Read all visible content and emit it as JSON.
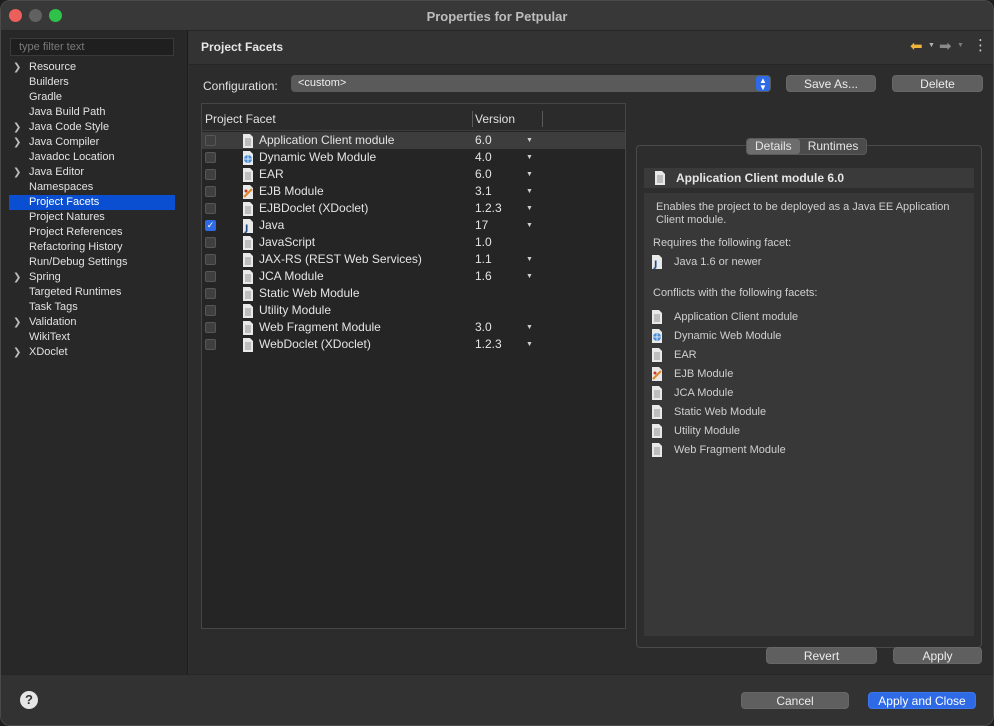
{
  "window": {
    "title": "Properties for Petpular"
  },
  "filter": {
    "placeholder": "type filter text"
  },
  "tree": [
    {
      "label": "Resource",
      "expandable": true
    },
    {
      "label": "Builders",
      "expandable": false
    },
    {
      "label": "Gradle",
      "expandable": false
    },
    {
      "label": "Java Build Path",
      "expandable": false
    },
    {
      "label": "Java Code Style",
      "expandable": true
    },
    {
      "label": "Java Compiler",
      "expandable": true
    },
    {
      "label": "Javadoc Location",
      "expandable": false
    },
    {
      "label": "Java Editor",
      "expandable": true
    },
    {
      "label": "Namespaces",
      "expandable": false
    },
    {
      "label": "Project Facets",
      "expandable": false,
      "selected": true
    },
    {
      "label": "Project Natures",
      "expandable": false
    },
    {
      "label": "Project References",
      "expandable": false
    },
    {
      "label": "Refactoring History",
      "expandable": false
    },
    {
      "label": "Run/Debug Settings",
      "expandable": false
    },
    {
      "label": "Spring",
      "expandable": true
    },
    {
      "label": "Targeted Runtimes",
      "expandable": false
    },
    {
      "label": "Task Tags",
      "expandable": false
    },
    {
      "label": "Validation",
      "expandable": true
    },
    {
      "label": "WikiText",
      "expandable": false
    },
    {
      "label": "XDoclet",
      "expandable": true
    }
  ],
  "page": {
    "title": "Project Facets",
    "config_label": "Configuration:",
    "config_value": "<custom>",
    "save_as": "Save As...",
    "delete": "Delete"
  },
  "table": {
    "col_facet": "Project Facet",
    "col_version": "Version",
    "rows": [
      {
        "name": "Application Client module",
        "version": "6.0",
        "checked": false,
        "dropdown": true,
        "icon": "doc-icon"
      },
      {
        "name": "Dynamic Web Module",
        "version": "4.0",
        "checked": false,
        "dropdown": true,
        "icon": "globe-icon"
      },
      {
        "name": "EAR",
        "version": "6.0",
        "checked": false,
        "dropdown": true,
        "icon": "doc-icon"
      },
      {
        "name": "EJB Module",
        "version": "3.1",
        "checked": false,
        "dropdown": true,
        "icon": "bean-icon"
      },
      {
        "name": "EJBDoclet (XDoclet)",
        "version": "1.2.3",
        "checked": false,
        "dropdown": true,
        "icon": "doc-icon"
      },
      {
        "name": "Java",
        "version": "17",
        "checked": true,
        "dropdown": true,
        "icon": "java-icon"
      },
      {
        "name": "JavaScript",
        "version": "1.0",
        "checked": false,
        "dropdown": false,
        "icon": "doc-icon"
      },
      {
        "name": "JAX-RS (REST Web Services)",
        "version": "1.1",
        "checked": false,
        "dropdown": true,
        "icon": "doc-icon"
      },
      {
        "name": "JCA Module",
        "version": "1.6",
        "checked": false,
        "dropdown": true,
        "icon": "doc-icon"
      },
      {
        "name": "Static Web Module",
        "version": "",
        "checked": false,
        "dropdown": false,
        "icon": "doc-icon"
      },
      {
        "name": "Utility Module",
        "version": "",
        "checked": false,
        "dropdown": false,
        "icon": "doc-icon"
      },
      {
        "name": "Web Fragment Module",
        "version": "3.0",
        "checked": false,
        "dropdown": true,
        "icon": "doc-icon"
      },
      {
        "name": "WebDoclet (XDoclet)",
        "version": "1.2.3",
        "checked": false,
        "dropdown": true,
        "icon": "doc-icon"
      }
    ]
  },
  "details": {
    "tab_details": "Details",
    "tab_runtimes": "Runtimes",
    "title": "Application Client module 6.0",
    "description": "Enables the project to be deployed as a Java EE Application Client module.",
    "requires_label": "Requires the following facet:",
    "requires": [
      {
        "name": "Java 1.6 or newer",
        "icon": "java-icon"
      }
    ],
    "conflicts_label": "Conflicts with the following facets:",
    "conflicts": [
      {
        "name": "Application Client module",
        "icon": "doc-icon"
      },
      {
        "name": "Dynamic Web Module",
        "icon": "globe-icon"
      },
      {
        "name": "EAR",
        "icon": "doc-icon"
      },
      {
        "name": "EJB Module",
        "icon": "bean-icon"
      },
      {
        "name": "JCA Module",
        "icon": "doc-icon"
      },
      {
        "name": "Static Web Module",
        "icon": "doc-icon"
      },
      {
        "name": "Utility Module",
        "icon": "doc-icon"
      },
      {
        "name": "Web Fragment Module",
        "icon": "doc-icon"
      }
    ]
  },
  "actions": {
    "revert": "Revert",
    "apply": "Apply",
    "cancel": "Cancel",
    "apply_close": "Apply and Close",
    "help": "?"
  },
  "colors": {
    "accent": "#2f6ae6",
    "selection": "#0a4fd1",
    "nav_back": "#f0b33b"
  }
}
